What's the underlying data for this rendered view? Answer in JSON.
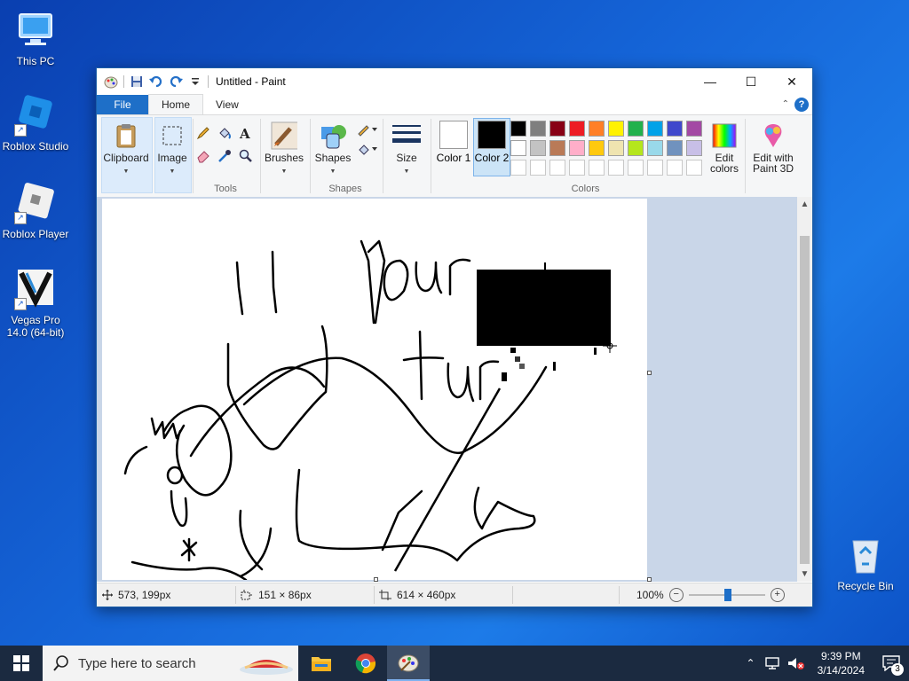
{
  "desktop": {
    "icons": [
      {
        "label": "This PC"
      },
      {
        "label": "Roblox Studio"
      },
      {
        "label": "Roblox Player"
      },
      {
        "label": "Vegas Pro 14.0 (64-bit)"
      },
      {
        "label": "Recycle Bin"
      }
    ]
  },
  "window": {
    "title": "Untitled - Paint",
    "controls": {
      "minimize": "—",
      "maximize": "☐",
      "close": "✕"
    }
  },
  "tabs": [
    {
      "label": "File"
    },
    {
      "label": "Home"
    },
    {
      "label": "View"
    }
  ],
  "help_label": "?",
  "ribbon": {
    "clipboard": {
      "label": "Clipboard"
    },
    "image": {
      "label": "Image"
    },
    "tools_group": "Tools",
    "brushes": {
      "label": "Brushes"
    },
    "shapes": {
      "label": "Shapes"
    },
    "shapes_group": "Shapes",
    "size": {
      "label": "Size"
    },
    "color1": {
      "label": "Color 1",
      "color": "#ffffff"
    },
    "color2": {
      "label": "Color 2",
      "color": "#000000",
      "selected": true
    },
    "colors_group": "Colors",
    "edit_colors": {
      "label": "Edit colors"
    },
    "edit_paint3d": {
      "label": "Edit with Paint 3D"
    },
    "palette_row1": [
      "#000000",
      "#7f7f7f",
      "#880015",
      "#ed1c24",
      "#ff7f27",
      "#fff200",
      "#22b14c",
      "#00a2e8",
      "#3f48cc",
      "#a349a4"
    ],
    "palette_row2": [
      "#ffffff",
      "#c3c3c3",
      "#b97a57",
      "#ffaec9",
      "#ffc90e",
      "#efe4b0",
      "#b5e61d",
      "#99d9ea",
      "#7092be",
      "#c8bfe7"
    ],
    "palette_row3_count": 10
  },
  "status": {
    "cursor_pos": "573, 199px",
    "selection_size": "151 × 86px",
    "image_size": "614 × 460px",
    "zoom": "100%",
    "zoom_minus": "−",
    "zoom_plus": "+"
  },
  "taskbar": {
    "search_placeholder": "Type here to search",
    "time": "9:39 PM",
    "date": "3/14/2024",
    "notifications": "3"
  }
}
